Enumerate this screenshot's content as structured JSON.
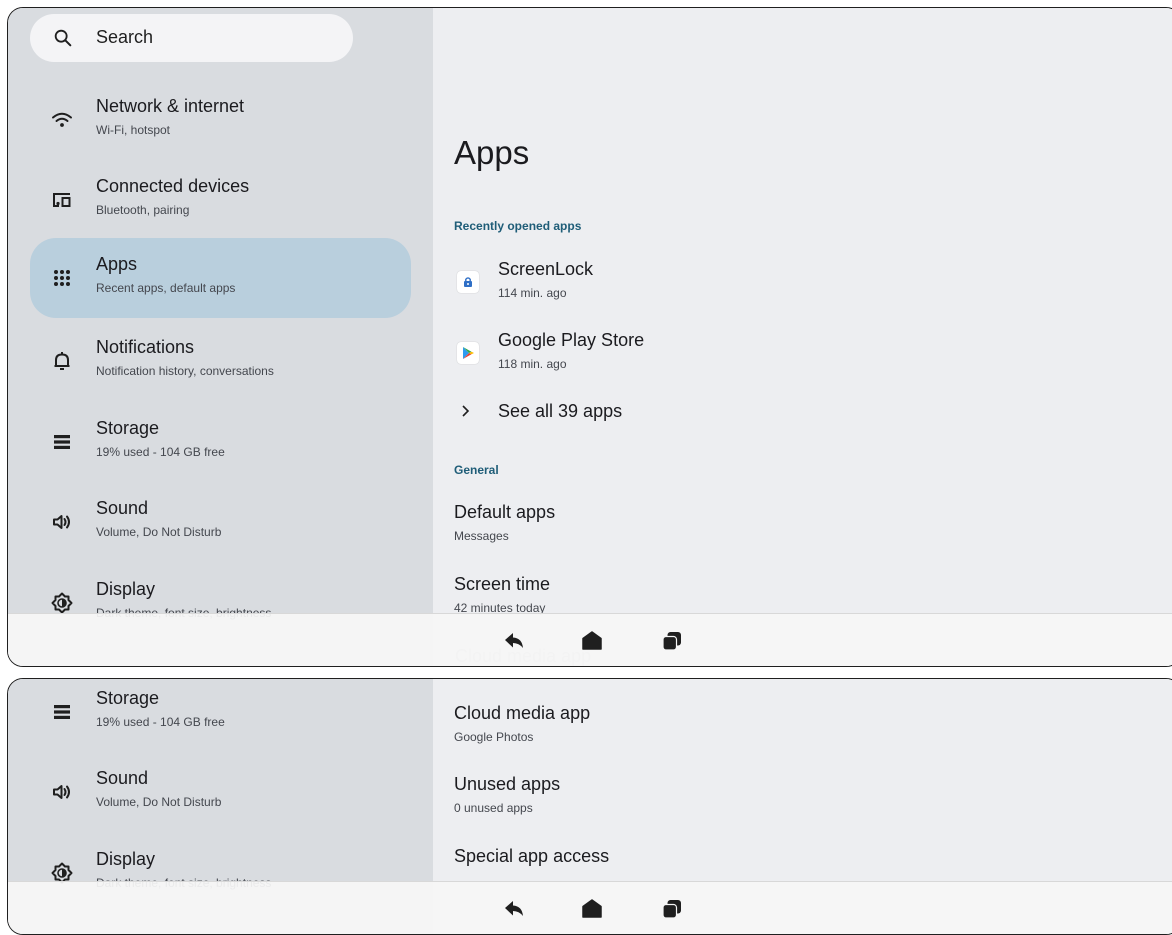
{
  "search": {
    "label": "Search"
  },
  "sidebar": {
    "items": [
      {
        "title": "Network & internet",
        "subtitle": "Wi-Fi, hotspot"
      },
      {
        "title": "Connected devices",
        "subtitle": "Bluetooth, pairing"
      },
      {
        "title": "Apps",
        "subtitle": "Recent apps, default apps"
      },
      {
        "title": "Notifications",
        "subtitle": "Notification history, conversations"
      },
      {
        "title": "Storage",
        "subtitle": "19% used - 104 GB free"
      },
      {
        "title": "Sound",
        "subtitle": "Volume, Do Not Disturb"
      },
      {
        "title": "Display",
        "subtitle": "Dark theme, font size, brightness"
      }
    ],
    "selected_index": 2
  },
  "main": {
    "title": "Apps",
    "recent_header": "Recently opened apps",
    "recent_apps": [
      {
        "name": "ScreenLock",
        "time": "114 min. ago",
        "icon": "screenlock-icon"
      },
      {
        "name": "Google Play Store",
        "time": "118 min. ago",
        "icon": "play-store-icon"
      }
    ],
    "see_all": "See all 39 apps",
    "general_header": "General",
    "general_items": [
      {
        "title": "Default apps",
        "subtitle": "Messages"
      },
      {
        "title": "Screen time",
        "subtitle": "42 minutes today"
      },
      {
        "title": "Cloud media app",
        "subtitle": "Google Photos"
      },
      {
        "title": "Unused apps",
        "subtitle": "0 unused apps"
      },
      {
        "title": "Special app access",
        "subtitle": ""
      }
    ]
  },
  "navbar": {
    "buttons": [
      "back-icon",
      "home-icon",
      "recents-icon"
    ]
  },
  "colors": {
    "selected_bg": "#b9cfdd",
    "section_header": "#1f5d78",
    "sidebar_bg": "#d9dce0",
    "content_bg": "#edeef1"
  }
}
